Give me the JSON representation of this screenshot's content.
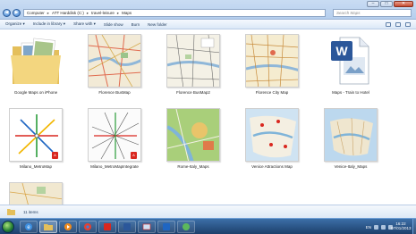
{
  "window": {
    "minimize": "–",
    "maximize": "□",
    "close": "✕"
  },
  "nav": {
    "back": "◀",
    "forward": "▶"
  },
  "address": {
    "crumbs": [
      "Computer",
      "ATT Harddisk (C:)",
      "travel-leisure",
      "Maps"
    ],
    "separator": "▸"
  },
  "search": {
    "placeholder": "Search Maps"
  },
  "toolbar": {
    "organize": "Organize ▾",
    "include": "Include in library ▾",
    "share": "Share with ▾",
    "slideshow": "Slide show",
    "burn": "Burn",
    "newfolder": "New folder"
  },
  "files": [
    {
      "name": "Google Maps on iPhone",
      "kind": "folder"
    },
    {
      "name": "Florence BusMap",
      "kind": "image"
    },
    {
      "name": "Florence BusMap2",
      "kind": "image"
    },
    {
      "name": "Florence City Map",
      "kind": "image"
    },
    {
      "name": "Maps - Train to Hotel",
      "kind": "word"
    },
    {
      "name": "Milano_MetroMap",
      "kind": "pdf"
    },
    {
      "name": "Milano_MetroMapIntegrate",
      "kind": "pdf"
    },
    {
      "name": "Rome-Italy_Maps",
      "kind": "image"
    },
    {
      "name": "Venice Attractions Map",
      "kind": "image"
    },
    {
      "name": "Venice-Italy_Maps",
      "kind": "image"
    },
    {
      "name": "",
      "kind": "image"
    }
  ],
  "details": {
    "count": "11 items"
  },
  "taskbar": {
    "apps": [
      "ie-icon",
      "explorer-icon",
      "media-player-icon",
      "chrome-icon",
      "acrobat-icon",
      "word-icon",
      "snipping-icon",
      "outlook-icon",
      "chat-icon"
    ],
    "lang": "EN",
    "time": "16:22",
    "date": "07/01/2013"
  },
  "colors": {
    "pdf": "#d9271f",
    "word": "#2b579a",
    "folder": "#e8c86a"
  }
}
